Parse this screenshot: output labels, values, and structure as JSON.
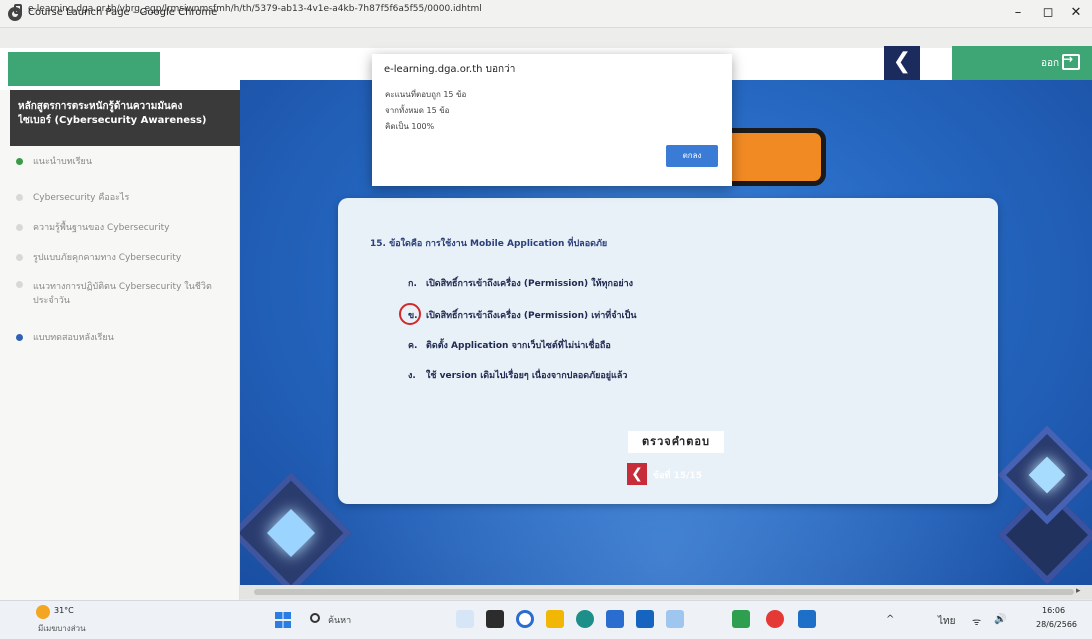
{
  "window": {
    "title": "Course Launch Page - Google Chrome",
    "url": "e-learning.dga.or.th/vhrg_egp/lrmsiwnmsfmh/h/th/5379-ab13-4v1e-a4kb-7h87f5f6a5f55/0000.idhtml",
    "minimize": "–",
    "maximize": "◻",
    "close": "✕"
  },
  "header": {
    "back_symbol": "❮",
    "exit_label": "ออก"
  },
  "sidebar": {
    "course_title_line1": "หลักสูตรการตระหนักรู้ด้านความมั่นคง",
    "course_title_line2": "ไซเบอร์ (Cybersecurity Awareness)",
    "items": [
      {
        "label": "แนะนำบทเรียน"
      },
      {
        "label": "Cybersecurity คืออะไร"
      },
      {
        "label": "ความรู้พื้นฐานของ Cybersecurity"
      },
      {
        "label": "รูปแบบภัยคุกคามทาง Cybersecurity"
      },
      {
        "label": "แนวทางการปฏิบัติตน Cybersecurity ในชีวิตประจำวัน"
      },
      {
        "label": "แบบทดสอบหลังเรียน"
      }
    ]
  },
  "dialog": {
    "title": "e-learning.dga.or.th บอกว่า",
    "line1": "คะแนนที่ตอบถูก 15 ข้อ",
    "line2": "จากทั้งหมด 15 ข้อ",
    "line3": "คิดเป็น 100%",
    "ok_label": "ตกลง"
  },
  "quiz": {
    "question": "15. ข้อใดคือ การใช้งาน Mobile Application ที่ปลอดภัย",
    "options": [
      {
        "letter": "ก.",
        "text": "เปิดสิทธิ์การเข้าถึงเครื่อง (Permission) ให้ทุกอย่าง"
      },
      {
        "letter": "ข.",
        "text": "เปิดสิทธิ์การเข้าถึงเครื่อง (Permission) เท่าที่จำเป็น"
      },
      {
        "letter": "ค.",
        "text": "ติดตั้ง Application จากเว็บไซต์ที่ไม่น่าเชื่อถือ"
      },
      {
        "letter": "ง.",
        "text": "ใช้ version เดิมไปเรื่อยๆ เนื่องจากปลอดภัยอยู่แล้ว"
      }
    ],
    "check_label": "ตรวจคำตอบ",
    "prev_symbol": "❮",
    "page": "ข้อที่ 15/15"
  },
  "scroll": {
    "arrow": "▸"
  },
  "taskbar": {
    "weather_temp": "31°C",
    "weather_desc": "มีเมฆบางส่วน",
    "search": "ค้นหา",
    "tray_up": "^",
    "tray_lang": "ไทย",
    "tray_wifi": "ᯤ",
    "tray_sound": "🔊",
    "time": "16:06",
    "date": "28/6/2566"
  },
  "colors": {
    "green": "#3ea675",
    "navy": "#1c2b5e",
    "stage_blue": "#2668c2",
    "orange": "#f28a24",
    "red_mark": "#d12a2a",
    "ok_blue": "#3a7bd5"
  }
}
